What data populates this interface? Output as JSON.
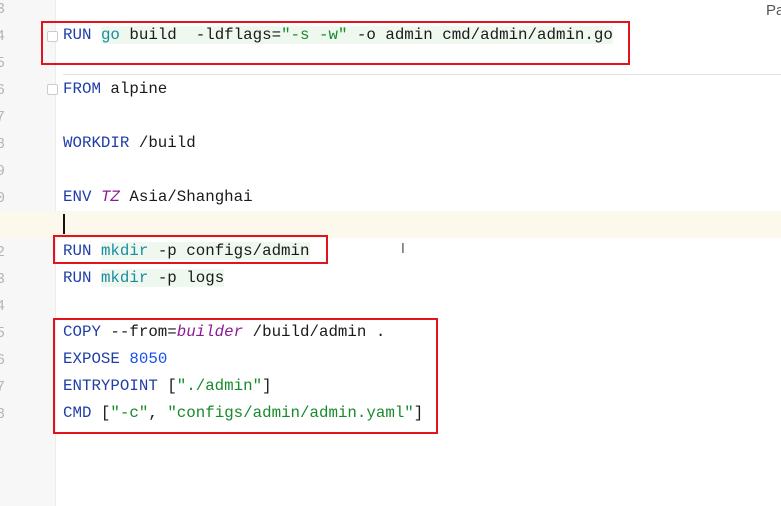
{
  "gutter": {
    "line_numbers": [
      "3",
      "4",
      "5",
      "6",
      "7",
      "8",
      "9",
      "0",
      "1",
      "2",
      "3",
      "4",
      "5",
      "6",
      "7",
      "8"
    ]
  },
  "top_right_label": "Pa",
  "code": {
    "l4": {
      "kw": "RUN",
      "cmd": "go",
      "a": " build  -ldflags=",
      "s": "\"-s -w\"",
      "b": " -o admin cmd/admin/admin.go"
    },
    "l6": {
      "kw": "FROM",
      "a": " alpine"
    },
    "l8": {
      "kw": "WORKDIR",
      "a": " /build"
    },
    "l10": {
      "kw": "ENV",
      "v": "TZ",
      "a": " Asia/Shanghai"
    },
    "l12": {
      "kw": "RUN",
      "cmd": "mkdir",
      "a": " -p configs/admin"
    },
    "l13": {
      "kw": "RUN",
      "cmd": "mkdir",
      "a": " -p logs"
    },
    "l15": {
      "kw": "COPY",
      "a": " --from=",
      "v": "builder",
      "b": " /build/admin ."
    },
    "l16": {
      "kw": "EXPOSE",
      "n": "8050"
    },
    "l17": {
      "kw": "ENTRYPOINT",
      "a": " [",
      "s": "\"./admin\"",
      "b": "]"
    },
    "l18": {
      "kw": "CMD",
      "a": " [",
      "s": "\"-c\"",
      "b": ", ",
      "s2": "\"configs/admin/admin.yaml\"",
      "c": "]"
    }
  },
  "colors": {
    "highlight_box": "#e3131b",
    "keyword": "#1f3ea8",
    "string": "#188a2a"
  }
}
